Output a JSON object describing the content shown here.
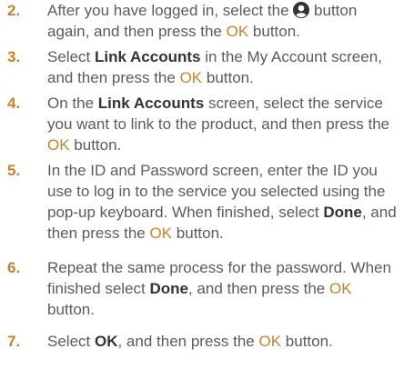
{
  "colors": {
    "accent": "#c8822b",
    "body_text": "#5b5b5b",
    "emphasis_text": "#333333"
  },
  "steps": [
    {
      "number": "2.",
      "parts": [
        "After you have logged in, select the",
        "button again, and then press the",
        "OK",
        "button."
      ],
      "icon": "account-icon"
    },
    {
      "number": "3.",
      "parts": [
        "Select",
        "Link Accounts",
        "in the My Account screen, and then press the",
        "OK",
        "button."
      ]
    },
    {
      "number": "4.",
      "parts": [
        "On the",
        "Link Accounts",
        "screen, select the service you want to link to the product, and then press the",
        "OK",
        "button."
      ]
    },
    {
      "number": "5.",
      "parts": [
        "In the ID and Password screen, enter the ID you use to log in to the service you selected using the pop-up keyboard. When finished, select",
        "Done",
        ", and then press the",
        "OK",
        "button."
      ]
    },
    {
      "number": "6.",
      "parts": [
        "Repeat the same process for the password. When finished select",
        "Done",
        ", and then press the",
        "OK",
        "button."
      ]
    },
    {
      "number": "7.",
      "parts": [
        "Select",
        "OK",
        ", and then press the",
        "OK",
        "button."
      ]
    }
  ]
}
